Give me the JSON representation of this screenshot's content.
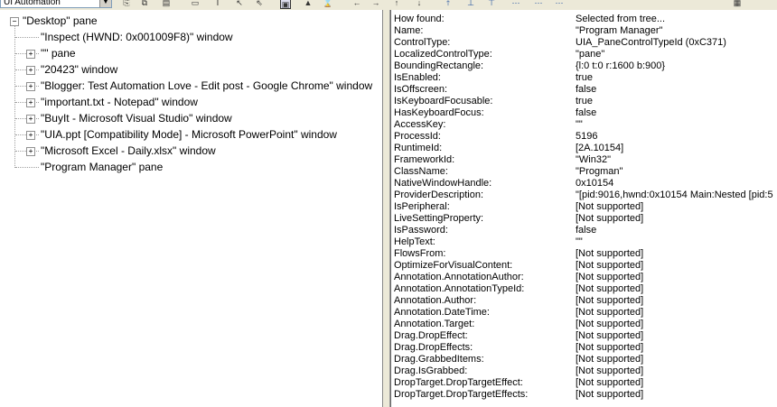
{
  "toolbar": {
    "mode_select": "UI Automation",
    "icons": [
      "copy-icon",
      "copy-tree-icon",
      "save-icon",
      "rectangle-icon",
      "caret-icon",
      "pointer-icon",
      "hover-icon",
      "focus-icon",
      "highlight-icon",
      "watch-cursor-icon",
      "back-icon",
      "forward-icon",
      "up-icon",
      "down-icon",
      "nav-up-icon",
      "parent-icon",
      "first-child-icon",
      "previous-icon",
      "next-icon",
      "last-child-icon",
      "refresh-icon"
    ]
  },
  "tree": [
    {
      "label": "\"Desktop\" pane",
      "level": 0,
      "expander": "-"
    },
    {
      "label": "\"Inspect  (HWND: 0x001009F8)\" window",
      "level": 1,
      "expander": ""
    },
    {
      "label": "\"\" pane",
      "level": 1,
      "expander": "+"
    },
    {
      "label": "\"20423\" window",
      "level": 1,
      "expander": "+"
    },
    {
      "label": "\"Blogger: Test Automation Love - Edit post - Google Chrome\" window",
      "level": 1,
      "expander": "+"
    },
    {
      "label": "\"important.txt - Notepad\" window",
      "level": 1,
      "expander": "+"
    },
    {
      "label": "\"BuyIt - Microsoft Visual Studio\" window",
      "level": 1,
      "expander": "+"
    },
    {
      "label": "\"UIA.ppt [Compatibility Mode] - Microsoft PowerPoint\" window",
      "level": 1,
      "expander": "+"
    },
    {
      "label": "\"Microsoft Excel - Daily.xlsx\" window",
      "level": 1,
      "expander": "+"
    },
    {
      "label": "\"Program Manager\" pane",
      "level": 1,
      "expander": ""
    }
  ],
  "properties": [
    {
      "name": "How found:",
      "value": "Selected from tree..."
    },
    {
      "name": "Name:",
      "value": "\"Program Manager\""
    },
    {
      "name": "ControlType:",
      "value": "UIA_PaneControlTypeId (0xC371)"
    },
    {
      "name": "LocalizedControlType:",
      "value": "\"pane\""
    },
    {
      "name": "BoundingRectangle:",
      "value": "{l:0 t:0 r:1600 b:900}"
    },
    {
      "name": "IsEnabled:",
      "value": "true"
    },
    {
      "name": "IsOffscreen:",
      "value": "false"
    },
    {
      "name": "IsKeyboardFocusable:",
      "value": "true"
    },
    {
      "name": "HasKeyboardFocus:",
      "value": "false"
    },
    {
      "name": "AccessKey:",
      "value": "\"\""
    },
    {
      "name": "ProcessId:",
      "value": "5196"
    },
    {
      "name": "RuntimeId:",
      "value": "[2A.10154]"
    },
    {
      "name": "FrameworkId:",
      "value": "\"Win32\""
    },
    {
      "name": "ClassName:",
      "value": "\"Progman\""
    },
    {
      "name": "NativeWindowHandle:",
      "value": "0x10154"
    },
    {
      "name": "ProviderDescription:",
      "value": "\"[pid:9016,hwnd:0x10154 Main:Nested [pid:5"
    },
    {
      "name": "IsPeripheral:",
      "value": "[Not supported]"
    },
    {
      "name": "LiveSettingProperty:",
      "value": "[Not supported]"
    },
    {
      "name": "IsPassword:",
      "value": "false"
    },
    {
      "name": "HelpText:",
      "value": "\"\""
    },
    {
      "name": "FlowsFrom:",
      "value": "[Not supported]"
    },
    {
      "name": "OptimizeForVisualContent:",
      "value": "[Not supported]"
    },
    {
      "name": "Annotation.AnnotationAuthor:",
      "value": "[Not supported]"
    },
    {
      "name": "Annotation.AnnotationTypeId:",
      "value": "[Not supported]"
    },
    {
      "name": "Annotation.Author:",
      "value": "[Not supported]"
    },
    {
      "name": "Annotation.DateTime:",
      "value": "[Not supported]"
    },
    {
      "name": "Annotation.Target:",
      "value": "[Not supported]"
    },
    {
      "name": "Drag.DropEffect:",
      "value": "[Not supported]"
    },
    {
      "name": "Drag.DropEffects:",
      "value": "[Not supported]"
    },
    {
      "name": "Drag.GrabbedItems:",
      "value": "[Not supported]"
    },
    {
      "name": "Drag.IsGrabbed:",
      "value": "[Not supported]"
    },
    {
      "name": "DropTarget.DropTargetEffect:",
      "value": "[Not supported]"
    },
    {
      "name": "DropTarget.DropTargetEffects:",
      "value": "[Not supported]"
    }
  ]
}
